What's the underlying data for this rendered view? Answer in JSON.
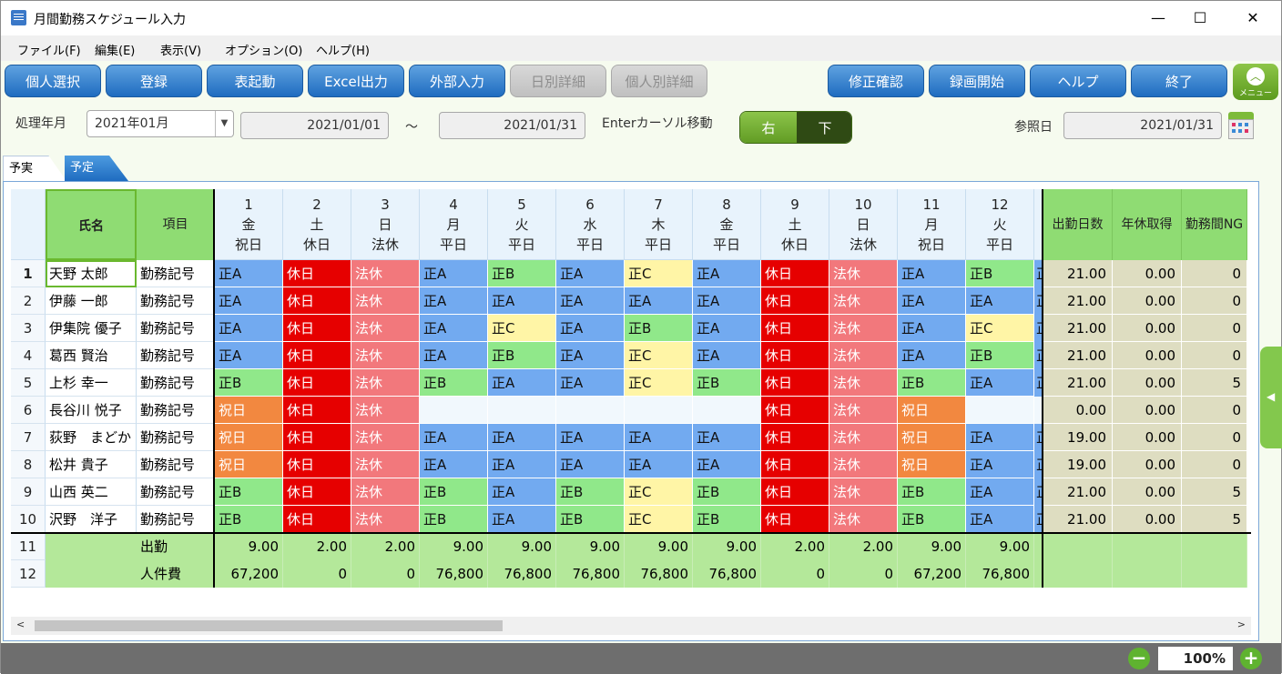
{
  "window": {
    "title": "月間勤務スケジュール入力",
    "minimize": "—",
    "maximize": "☐",
    "close": "✕"
  },
  "menu": [
    "ファイル(F)",
    "編集(E)",
    "表示(V)",
    "オプション(O)",
    "ヘルプ(H)"
  ],
  "toolbar": {
    "left": [
      {
        "label": "個人選択",
        "enabled": true
      },
      {
        "label": "登録",
        "enabled": true
      },
      {
        "label": "表起動",
        "enabled": true
      },
      {
        "label": "Excel出力",
        "enabled": true
      },
      {
        "label": "外部入力",
        "enabled": true
      },
      {
        "label": "日別詳細",
        "enabled": false
      },
      {
        "label": "個人別詳細",
        "enabled": false
      }
    ],
    "right": [
      {
        "label": "修正確認",
        "enabled": true
      },
      {
        "label": "録画開始",
        "enabled": true
      },
      {
        "label": "ヘルプ",
        "enabled": true
      },
      {
        "label": "終了",
        "enabled": true
      }
    ],
    "menu_icon_label": "メニュー"
  },
  "filter": {
    "label_ym": "処理年月",
    "ym_value": "2021年01月",
    "from": "2021/01/01",
    "tilde": "～",
    "to": "2021/01/31",
    "enter_label": "Enterカーソル移動",
    "toggle_right": "右",
    "toggle_down": "下",
    "ref_label": "参照日",
    "ref_value": "2021/01/31"
  },
  "tabs": [
    "予実",
    "予定"
  ],
  "grid": {
    "h_name": "氏名",
    "h_item": "項目",
    "days": [
      {
        "d": "1",
        "w": "金",
        "t": "祝日"
      },
      {
        "d": "2",
        "w": "土",
        "t": "休日"
      },
      {
        "d": "3",
        "w": "日",
        "t": "法休"
      },
      {
        "d": "4",
        "w": "月",
        "t": "平日"
      },
      {
        "d": "5",
        "w": "火",
        "t": "平日"
      },
      {
        "d": "6",
        "w": "水",
        "t": "平日"
      },
      {
        "d": "7",
        "w": "木",
        "t": "平日"
      },
      {
        "d": "8",
        "w": "金",
        "t": "平日"
      },
      {
        "d": "9",
        "w": "土",
        "t": "休日"
      },
      {
        "d": "10",
        "w": "日",
        "t": "法休"
      },
      {
        "d": "11",
        "w": "月",
        "t": "祝日"
      },
      {
        "d": "12",
        "w": "火",
        "t": "平日"
      }
    ],
    "summary_headers": [
      "出勤日数",
      "年休取得",
      "勤務間NG"
    ],
    "rows": [
      {
        "no": "1",
        "name": "天野 太郎",
        "item": "勤務記号",
        "cells": [
          "正A",
          "休日",
          "法休",
          "正A",
          "正B",
          "正A",
          "正C",
          "正A",
          "休日",
          "法休",
          "正A",
          "正B"
        ],
        "sum": [
          "21.00",
          "0.00",
          "0"
        ]
      },
      {
        "no": "2",
        "name": "伊藤 一郎",
        "item": "勤務記号",
        "cells": [
          "正A",
          "休日",
          "法休",
          "正A",
          "正A",
          "正A",
          "正A",
          "正A",
          "休日",
          "法休",
          "正A",
          "正A"
        ],
        "sum": [
          "21.00",
          "0.00",
          "0"
        ]
      },
      {
        "no": "3",
        "name": "伊集院 優子",
        "item": "勤務記号",
        "cells": [
          "正A",
          "休日",
          "法休",
          "正A",
          "正C",
          "正A",
          "正B",
          "正A",
          "休日",
          "法休",
          "正A",
          "正C"
        ],
        "sum": [
          "21.00",
          "0.00",
          "0"
        ]
      },
      {
        "no": "4",
        "name": "葛西 賢治",
        "item": "勤務記号",
        "cells": [
          "正A",
          "休日",
          "法休",
          "正A",
          "正B",
          "正A",
          "正C",
          "正A",
          "休日",
          "法休",
          "正A",
          "正B"
        ],
        "sum": [
          "21.00",
          "0.00",
          "0"
        ]
      },
      {
        "no": "5",
        "name": "上杉 幸一",
        "item": "勤務記号",
        "cells": [
          "正B",
          "休日",
          "法休",
          "正B",
          "正A",
          "正A",
          "正C",
          "正B",
          "休日",
          "法休",
          "正B",
          "正A"
        ],
        "sum": [
          "21.00",
          "0.00",
          "5"
        ]
      },
      {
        "no": "6",
        "name": "長谷川 悦子",
        "item": "勤務記号",
        "cells": [
          "祝日",
          "休日",
          "法休",
          "",
          "",
          "",
          "",
          "",
          "休日",
          "法休",
          "祝日",
          ""
        ],
        "sum": [
          "0.00",
          "0.00",
          "0"
        ]
      },
      {
        "no": "7",
        "name": "荻野　まどか",
        "item": "勤務記号",
        "cells": [
          "祝日",
          "休日",
          "法休",
          "正A",
          "正A",
          "正A",
          "正A",
          "正A",
          "休日",
          "法休",
          "祝日",
          "正A"
        ],
        "sum": [
          "19.00",
          "0.00",
          "0"
        ]
      },
      {
        "no": "8",
        "name": "松井 貴子",
        "item": "勤務記号",
        "cells": [
          "祝日",
          "休日",
          "法休",
          "正A",
          "正A",
          "正A",
          "正A",
          "正A",
          "休日",
          "法休",
          "祝日",
          "正A"
        ],
        "sum": [
          "19.00",
          "0.00",
          "0"
        ]
      },
      {
        "no": "9",
        "name": "山西 英二",
        "item": "勤務記号",
        "cells": [
          "正B",
          "休日",
          "法休",
          "正B",
          "正A",
          "正B",
          "正C",
          "正B",
          "休日",
          "法休",
          "正B",
          "正A"
        ],
        "sum": [
          "21.00",
          "0.00",
          "5"
        ]
      },
      {
        "no": "10",
        "name": "沢野　洋子",
        "item": "勤務記号",
        "cells": [
          "正B",
          "休日",
          "法休",
          "正B",
          "正A",
          "正B",
          "正C",
          "正B",
          "休日",
          "法休",
          "正B",
          "正A"
        ],
        "sum": [
          "21.00",
          "0.00",
          "5"
        ]
      }
    ],
    "totals": [
      {
        "no": "11",
        "label": "出勤",
        "values": [
          "9.00",
          "2.00",
          "2.00",
          "9.00",
          "9.00",
          "9.00",
          "9.00",
          "9.00",
          "2.00",
          "2.00",
          "9.00",
          "9.00"
        ]
      },
      {
        "no": "12",
        "label": "人件費",
        "values": [
          "67,200",
          "0",
          "0",
          "76,800",
          "76,800",
          "76,800",
          "76,800",
          "76,800",
          "0",
          "0",
          "67,200",
          "76,800"
        ]
      }
    ],
    "partial_col_glyph": "正",
    "colors": {
      "正A": "#72aaf0",
      "正B": "#90e88a",
      "正C": "#fff5a6",
      "休日": "#e60000",
      "法休": "#f2787c",
      "祝日": "#f28840",
      "": "#f1f8fd"
    }
  },
  "status": {
    "zoom": "100%",
    "minus": "−",
    "plus": "+"
  }
}
